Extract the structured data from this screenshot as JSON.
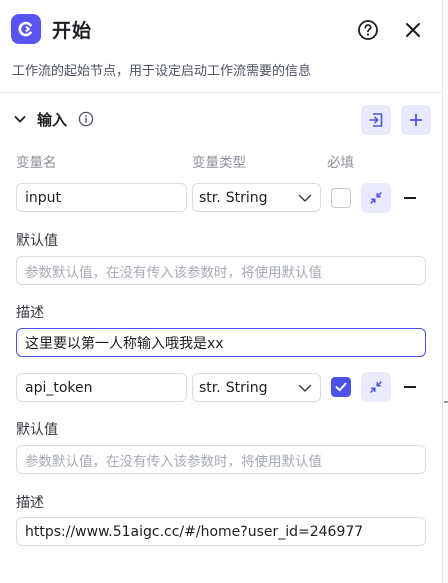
{
  "header": {
    "title": "开始"
  },
  "description": "工作流的起始节点，用于设定启动工作流需要的信息",
  "input_section": {
    "title": "输入",
    "columns": {
      "name": "变量名",
      "type": "变量类型",
      "required": "必填"
    }
  },
  "params": [
    {
      "name": "input",
      "type_prefix": "str.",
      "type": "String",
      "required": false,
      "default_label": "默认值",
      "default_value": "",
      "default_placeholder": "参数默认值，在没有传入该参数时，将使用默认值",
      "desc_label": "描述",
      "desc_value": "这里要以第一人称输入哦我是xx"
    },
    {
      "name": "api_token",
      "type_prefix": "str.",
      "type": "String",
      "required": true,
      "default_label": "默认值",
      "default_value": "",
      "default_placeholder": "参数默认值，在没有传入该参数时，将使用默认值",
      "desc_label": "描述",
      "desc_value": "https://www.51aigc.cc/#/home?user_id=246977"
    }
  ],
  "colors": {
    "accent": "#4d53e8",
    "logo": "#5a55f0",
    "soft_accent": "#e9ebfd"
  }
}
